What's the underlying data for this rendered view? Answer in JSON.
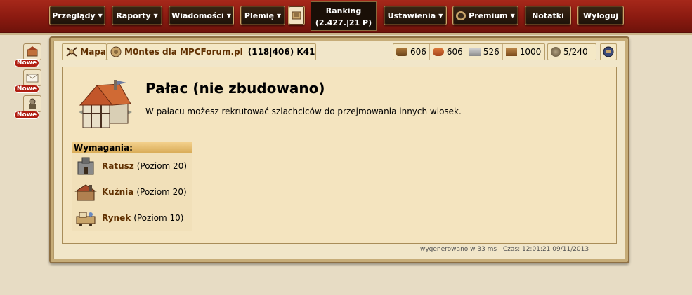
{
  "topnav": {
    "items": [
      "Przeglądy",
      "Raporty",
      "Wiadomości",
      "Plemię"
    ],
    "ranking_label": "Ranking",
    "ranking_value": "(2.427.|21 P)",
    "items_right": [
      "Ustawienia",
      "Premium",
      "Notatki",
      "Wyloguj"
    ]
  },
  "notifications": {
    "badge": "Nowe"
  },
  "header": {
    "map_label": "Mapa",
    "village_name": "M0ntes dla MPCForum.pl",
    "village_coords": "(118|406) K41"
  },
  "resources": {
    "wood": "606",
    "clay": "606",
    "iron": "526",
    "storage": "1000",
    "population": "5/240"
  },
  "building": {
    "title": "Pałac (nie zbudowano)",
    "description": "W pałacu możesz rekrutować szlachciców do przejmowania innych wiosek."
  },
  "requirements": {
    "header": "Wymagania:",
    "items": [
      {
        "name": "Ratusz",
        "level": "(Poziom 20)"
      },
      {
        "name": "Kuźnia",
        "level": "(Poziom 20)"
      },
      {
        "name": "Rynek",
        "level": "(Poziom 10)"
      }
    ]
  },
  "footer": {
    "text": "wygenerowano w 33 ms | Czas: 12:01:21 09/11/2013"
  },
  "colors": {
    "topbar": "#8a1a10",
    "link": "#603000",
    "badge": "#b01e12"
  }
}
